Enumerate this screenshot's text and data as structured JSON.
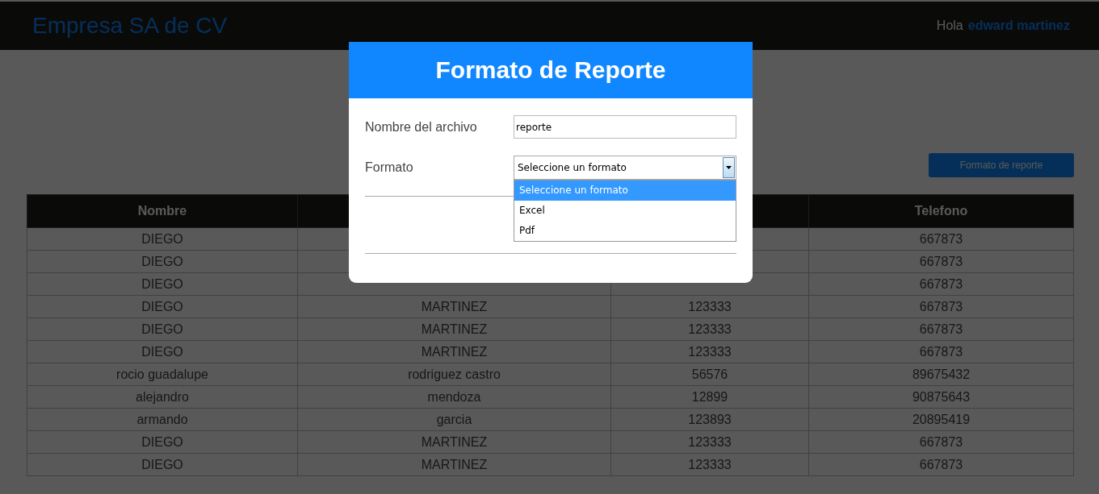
{
  "header": {
    "brand": "Empresa SA de CV",
    "greeting": "Hola",
    "user": "edward martinez"
  },
  "report_button": "Formato de reporte",
  "table": {
    "columns": [
      "Nombre",
      null,
      null,
      "Telefono"
    ],
    "rows": [
      [
        "DIEGO",
        null,
        null,
        "667873"
      ],
      [
        "DIEGO",
        null,
        null,
        "667873"
      ],
      [
        "DIEGO",
        null,
        null,
        "667873"
      ],
      [
        "DIEGO",
        "MARTINEZ",
        "123333",
        "667873"
      ],
      [
        "DIEGO",
        "MARTINEZ",
        "123333",
        "667873"
      ],
      [
        "DIEGO",
        "MARTINEZ",
        "123333",
        "667873"
      ],
      [
        "rocio guadalupe",
        "rodriguez castro",
        "56576",
        "89675432"
      ],
      [
        "alejandro",
        "mendoza",
        "12899",
        "90875643"
      ],
      [
        "armando",
        "garcia",
        "123893",
        "20895419"
      ],
      [
        "DIEGO",
        "MARTINEZ",
        "123333",
        "667873"
      ],
      [
        "DIEGO",
        "MARTINEZ",
        "123333",
        "667873"
      ]
    ]
  },
  "modal": {
    "title": "Formato de Reporte",
    "filename": {
      "label": "Nombre del archivo",
      "value": "reporte"
    },
    "format": {
      "label": "Formato",
      "value": "Seleccione un formato",
      "expanded": true,
      "options": [
        {
          "label": "Seleccione un formato",
          "selected": true
        },
        {
          "label": "Excel",
          "selected": false
        },
        {
          "label": "Pdf",
          "selected": false
        }
      ]
    }
  }
}
